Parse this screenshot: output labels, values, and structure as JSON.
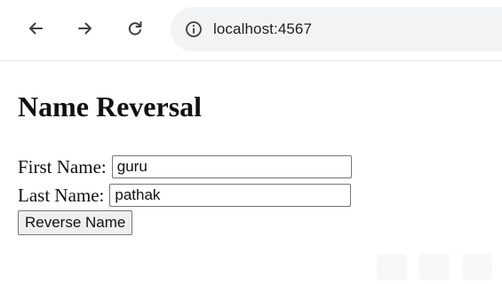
{
  "browser": {
    "back_icon": "arrow-left-icon",
    "forward_icon": "arrow-right-icon",
    "reload_icon": "reload-icon",
    "info_icon": "info-circle-icon",
    "url": "localhost:4567"
  },
  "page": {
    "heading": "Name Reversal",
    "first_name_label": "First Name:",
    "first_name_value": "guru",
    "last_name_label": "Last Name:",
    "last_name_value": "pathak",
    "button_label": "Reverse Name"
  }
}
